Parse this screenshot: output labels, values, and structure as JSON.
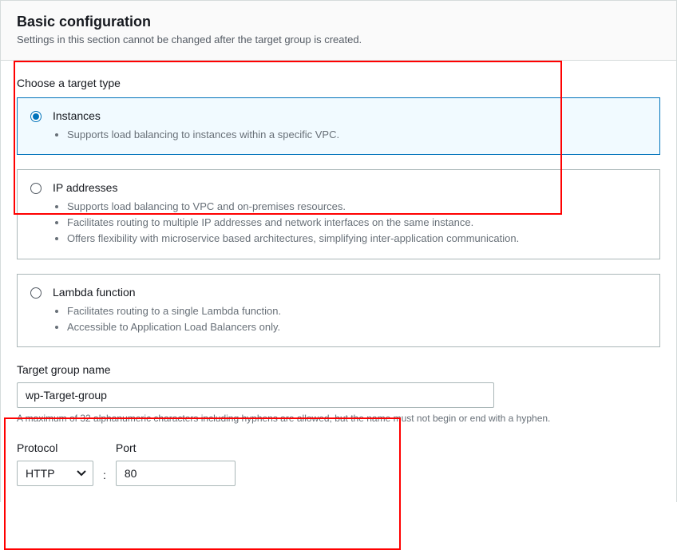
{
  "header": {
    "title": "Basic configuration",
    "description": "Settings in this section cannot be changed after the target group is created."
  },
  "target_type": {
    "label": "Choose a target type",
    "options": [
      {
        "title": "Instances",
        "selected": true,
        "bullets": [
          "Supports load balancing to instances within a specific VPC."
        ]
      },
      {
        "title": "IP addresses",
        "selected": false,
        "bullets": [
          "Supports load balancing to VPC and on-premises resources.",
          "Facilitates routing to multiple IP addresses and network interfaces on the same instance.",
          "Offers flexibility with microservice based architectures, simplifying inter-application communication."
        ]
      },
      {
        "title": "Lambda function",
        "selected": false,
        "bullets": [
          "Facilitates routing to a single Lambda function.",
          "Accessible to Application Load Balancers only."
        ]
      }
    ]
  },
  "target_group_name": {
    "label": "Target group name",
    "value": "wp-Target-group",
    "helper": "A maximum of 32 alphanumeric characters including hyphens are allowed, but the name must not begin or end with a hyphen."
  },
  "protocol": {
    "label": "Protocol",
    "value": "HTTP"
  },
  "port": {
    "label": "Port",
    "value": "80"
  },
  "colon": ":"
}
